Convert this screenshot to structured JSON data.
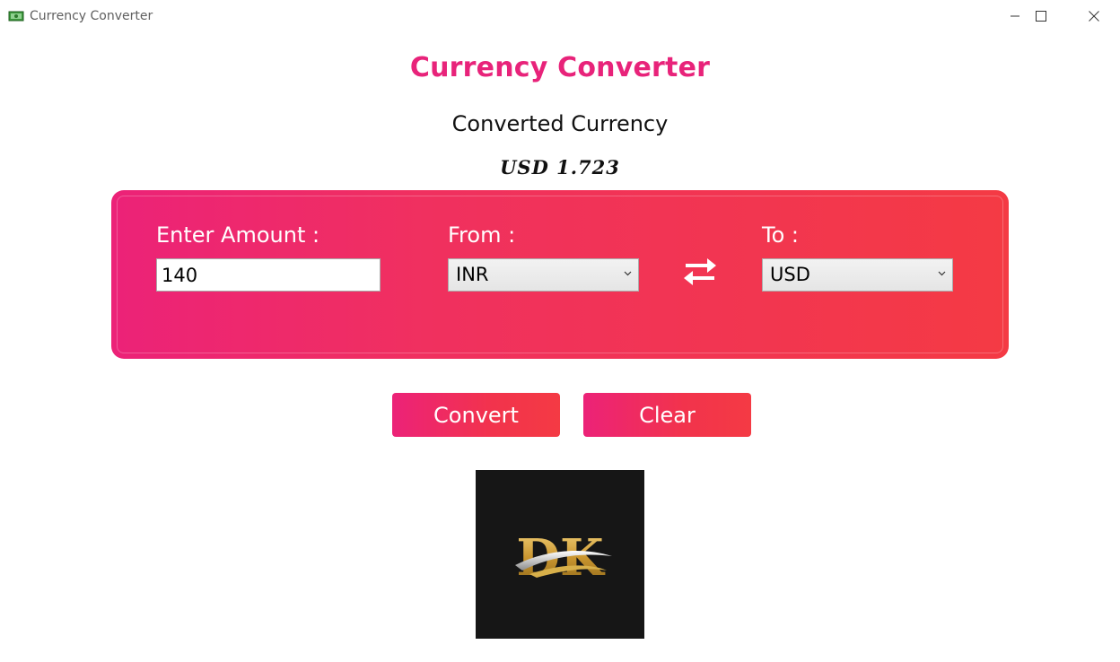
{
  "window": {
    "title": "Currency Converter",
    "icon": "money-icon",
    "controls": [
      "minimize-icon",
      "maximize-icon",
      "close-icon"
    ]
  },
  "header": {
    "title": "Currency Converter",
    "subtitle": "Converted Currency",
    "result": "USD 1.723"
  },
  "form": {
    "amount_label": "Enter Amount :",
    "amount_value": "140",
    "from_label": "From :",
    "from_value": "INR",
    "to_label": "To :",
    "to_value": "USD",
    "swap_icon": "swap-arrows-icon"
  },
  "actions": {
    "convert_label": "Convert",
    "clear_label": "Clear"
  },
  "logo": {
    "text": "DK"
  },
  "colors": {
    "accent": "#e8237a",
    "panel_start": "#ec2278",
    "panel_end": "#f43a44"
  }
}
